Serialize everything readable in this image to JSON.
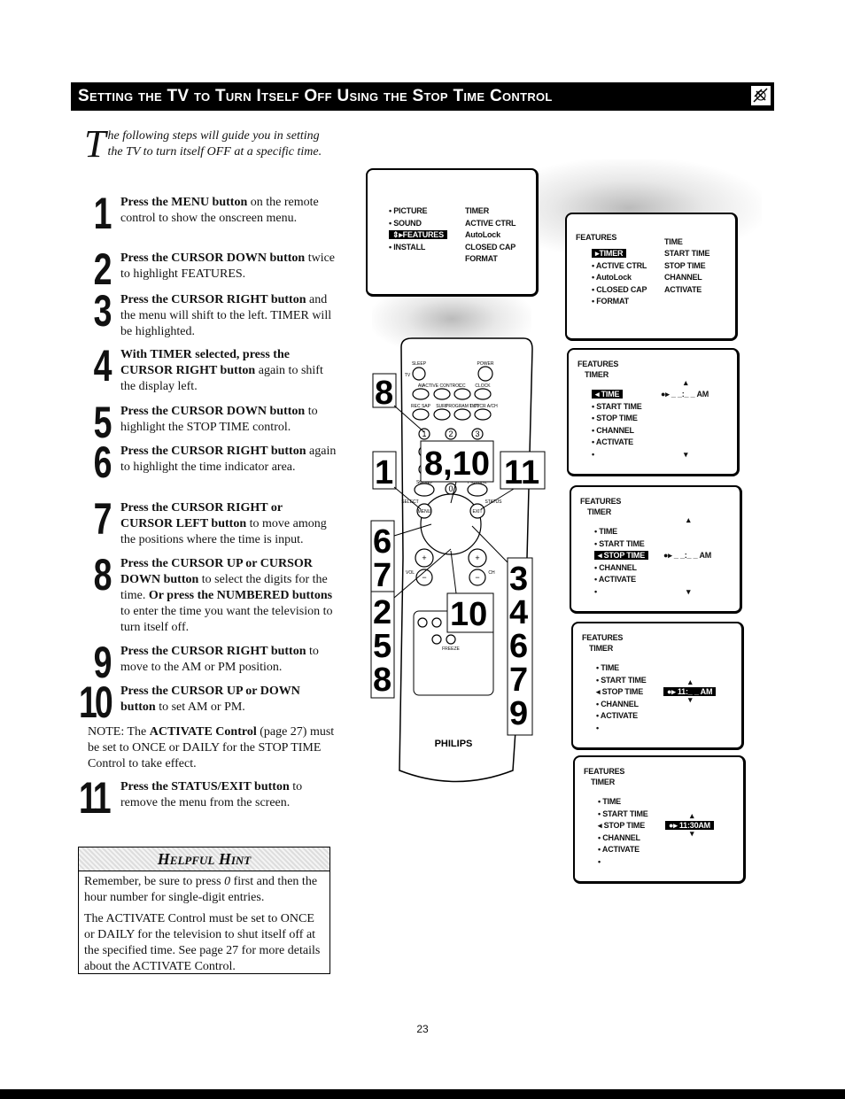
{
  "title": "Setting the TV to Turn Itself Off Using the Stop Time Control",
  "intro": {
    "drop_cap": "T",
    "text": "he following steps will guide you in setting the TV to turn itself OFF at a specific time."
  },
  "steps": [
    {
      "num": "1",
      "segments": [
        {
          "t": "Press the MENU button",
          "b": true
        },
        {
          "t": " on the remote control to show the onscreen menu.",
          "b": false
        }
      ]
    },
    {
      "num": "2",
      "segments": [
        {
          "t": "Press the CURSOR DOWN button",
          "b": true
        },
        {
          "t": " twice to highlight FEATURES.",
          "b": false
        }
      ]
    },
    {
      "num": "3",
      "segments": [
        {
          "t": "Press the CURSOR RIGHT button",
          "b": true
        },
        {
          "t": " and the menu will shift to the left. TIMER will be highlighted.",
          "b": false
        }
      ]
    },
    {
      "num": "4",
      "segments": [
        {
          "t": "With TIMER selected, press the CURSOR RIGHT button",
          "b": true
        },
        {
          "t": " again to shift the display left.",
          "b": false
        }
      ]
    },
    {
      "num": "5",
      "segments": [
        {
          "t": "Press the CURSOR DOWN button",
          "b": true
        },
        {
          "t": " to highlight the STOP TIME control.",
          "b": false
        }
      ]
    },
    {
      "num": "6",
      "segments": [
        {
          "t": "Press the CURSOR RIGHT button",
          "b": true
        },
        {
          "t": " again to highlight the time indicator area.",
          "b": false
        }
      ]
    },
    {
      "num": "7",
      "segments": [
        {
          "t": "Press the CURSOR RIGHT or CURSOR LEFT button",
          "b": true
        },
        {
          "t": " to move among the positions where the time is input.",
          "b": false
        }
      ]
    },
    {
      "num": "8",
      "segments": [
        {
          "t": "Press the CURSOR UP or CURSOR DOWN button",
          "b": true
        },
        {
          "t": " to select the digits for the time. ",
          "b": false
        },
        {
          "t": "Or press the NUMBERED buttons",
          "b": true
        },
        {
          "t": " to enter the time you want the television to turn itself off.",
          "b": false
        }
      ]
    },
    {
      "num": "9",
      "segments": [
        {
          "t": "Press the CURSOR RIGHT button",
          "b": true
        },
        {
          "t": " to move to the AM or PM position.",
          "b": false
        }
      ]
    },
    {
      "num": "10",
      "segments": [
        {
          "t": "Press the CURSOR UP or DOWN button",
          "b": true
        },
        {
          "t": " to set AM or PM.",
          "b": false
        }
      ]
    },
    {
      "num": "11",
      "segments": [
        {
          "t": "Press the STATUS/EXIT button",
          "b": true
        },
        {
          "t": " to remove the menu from the screen.",
          "b": false
        }
      ]
    }
  ],
  "note": {
    "prefix": "NOTE: The ",
    "bold": "ACTIVATE Control",
    "suffix": " (page 27) must be set to ONCE or DAILY for the STOP TIME Control to take effect."
  },
  "hint": {
    "title": "Helpful Hint",
    "p1_a": "Remember, be sure to press ",
    "p1_zero": "0",
    "p1_b": " first and then the hour number for single-digit entries.",
    "p2": "The ACTIVATE Control must be set to ONCE or DAILY for the television to shut itself off at the specified time. See page 27 for more details about the ACTIVATE Control."
  },
  "screens": [
    {
      "left": [
        "• PICTURE",
        "• SOUND",
        "⇕▸FEATURES",
        "• INSTALL"
      ],
      "hl": 2,
      "right": [
        "TIMER",
        "ACTIVE CTRL",
        "AutoLock",
        "CLOSED CAP",
        "FORMAT"
      ]
    },
    {
      "header": "FEATURES",
      "left": [
        "▸TIMER",
        "• ACTIVE CTRL",
        "• AutoLock",
        "• CLOSED CAP",
        "• FORMAT"
      ],
      "hl": 0,
      "right": [
        "TIME",
        "START TIME",
        "STOP TIME",
        "CHANNEL",
        "ACTIVATE"
      ]
    },
    {
      "header": "FEATURES",
      "sub": "TIMER",
      "left": [
        "◂ TIME",
        "• START TIME",
        "• STOP TIME",
        "• CHANNEL",
        "• ACTIVATE",
        "•"
      ],
      "hl": 0,
      "value": "●▸ _ _:_ _ AM",
      "valueRow": 0,
      "valueHl": false
    },
    {
      "header": "FEATURES",
      "sub": "TIMER",
      "left": [
        "• TIME",
        "• START TIME",
        "◂ STOP TIME",
        "• CHANNEL",
        "• ACTIVATE",
        "•"
      ],
      "hl": 2,
      "value": "●▸ _ _:_ _ AM",
      "valueRow": 2,
      "valueHl": false
    },
    {
      "header": "FEATURES",
      "sub": "TIMER",
      "left": [
        "• TIME",
        "• START TIME",
        "◂ STOP TIME",
        "• CHANNEL",
        "• ACTIVATE",
        "•"
      ],
      "hl": -1,
      "value": "●▸  11:_ _ AM",
      "valueRow": 2,
      "valueHl": true
    },
    {
      "header": "FEATURES",
      "sub": "TIMER",
      "left": [
        "• TIME",
        "• START TIME",
        "◂ STOP TIME",
        "• CHANNEL",
        "• ACTIVATE",
        "•"
      ],
      "hl": -1,
      "value": "●▸  11:30AM",
      "valueRow": 2,
      "valueHl": true
    }
  ],
  "remote": {
    "brand": "PHILIPS",
    "buttons": [
      "SLEEP",
      "POWER",
      "TV",
      "AV",
      "ACTIVE CONTROL",
      "CC",
      "CLOCK",
      "REC SAP",
      "SURF",
      "PROGRAM LIST",
      "TV/VCR A/CH",
      "1",
      "2",
      "3",
      "4",
      "7",
      "0",
      "SOUND",
      "PICTURE",
      "SELECT",
      "MENU",
      "EXIT",
      "STATUS",
      "VOL",
      "CH",
      "+",
      "+",
      "−",
      "−",
      "FREEZE"
    ],
    "callouts": {
      "c8": "8",
      "c1": "1",
      "c810": "8,10",
      "c11": "11",
      "c67": "6\n7",
      "c258": "2\n5\n8",
      "c10": "10",
      "c3467": "3\n4\n6\n7\n9"
    }
  },
  "page_number": "23"
}
